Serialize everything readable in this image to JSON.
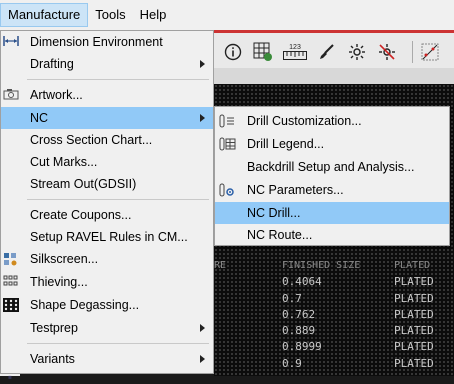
{
  "menubar": {
    "items": [
      {
        "label": "Manufacture",
        "active": true
      },
      {
        "label": "Tools",
        "active": false
      },
      {
        "label": "Help",
        "active": false
      }
    ]
  },
  "toolbar": {
    "icons": [
      "info-icon",
      "grid-info-icon",
      "ruler-icon",
      "brush-icon",
      "sun-icon",
      "sun-off-icon",
      "scatter-icon"
    ],
    "ruler_text": "123"
  },
  "manufacture_menu": {
    "items": [
      {
        "label": "Dimension Environment",
        "icon": "dimension-icon",
        "submenu": false
      },
      {
        "label": "Drafting",
        "icon": "",
        "submenu": true
      },
      {
        "label": "Artwork...",
        "icon": "camera-icon",
        "submenu": false
      },
      {
        "label": "NC",
        "icon": "",
        "submenu": true,
        "highlight": true
      },
      {
        "label": "Cross Section Chart...",
        "icon": "",
        "submenu": false
      },
      {
        "label": "Cut Marks...",
        "icon": "",
        "submenu": false
      },
      {
        "label": "Stream Out(GDSII)",
        "icon": "",
        "submenu": false
      },
      {
        "label": "Create Coupons...",
        "icon": "",
        "submenu": false
      },
      {
        "label": "Setup RAVEL Rules in CM...",
        "icon": "",
        "submenu": false
      },
      {
        "label": "Silkscreen...",
        "icon": "silkscreen-icon",
        "submenu": false
      },
      {
        "label": "Thieving...",
        "icon": "thieving-icon",
        "submenu": false
      },
      {
        "label": "Shape Degassing...",
        "icon": "degassing-icon",
        "submenu": false
      },
      {
        "label": "Testprep",
        "icon": "",
        "submenu": true
      },
      {
        "label": "Variants",
        "icon": "",
        "submenu": true
      }
    ]
  },
  "nc_submenu": {
    "items": [
      {
        "label": "Drill Customization...",
        "icon": "drill-custom-icon"
      },
      {
        "label": "Drill Legend...",
        "icon": "drill-legend-icon"
      },
      {
        "label": "Backdrill Setup and Analysis...",
        "icon": ""
      },
      {
        "label": "NC Parameters...",
        "icon": "nc-params-icon"
      },
      {
        "label": "NC Drill...",
        "icon": "",
        "highlight": true
      },
      {
        "label": "NC Route...",
        "icon": ""
      }
    ]
  },
  "drill_table": {
    "header": [
      "RE",
      "FINISHED SIZE",
      "PLATED"
    ],
    "rows": [
      [
        "",
        "0.4064",
        "PLATED"
      ],
      [
        "",
        "0.7",
        "PLATED"
      ],
      [
        "",
        "0.762",
        "PLATED"
      ],
      [
        "",
        "0.889",
        "PLATED"
      ],
      [
        "",
        "0.8999",
        "PLATED"
      ],
      [
        "",
        "0.9",
        "PLATED"
      ]
    ]
  },
  "colors": {
    "highlight": "#91c9f7",
    "menu_bg": "#f0f0f0",
    "canvas_bg": "#0c0c0c",
    "toolbar_accent": "#cc3333"
  }
}
